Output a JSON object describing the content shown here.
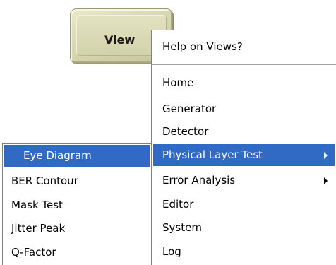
{
  "button": {
    "label": "View"
  },
  "menu": {
    "help": "Help on Views?",
    "items": [
      {
        "label": "Home",
        "has_submenu": false
      },
      {
        "label": "Generator",
        "has_submenu": false
      },
      {
        "label": "Detector",
        "has_submenu": false
      },
      {
        "label": "Physical Layer Test",
        "has_submenu": true,
        "selected": true
      },
      {
        "label": "Error Analysis",
        "has_submenu": true
      },
      {
        "label": "Editor",
        "has_submenu": false
      },
      {
        "label": "System",
        "has_submenu": false
      },
      {
        "label": "Log",
        "has_submenu": false
      }
    ]
  },
  "submenu": {
    "items": [
      {
        "label": "Eye Diagram",
        "selected": true
      },
      {
        "label": "BER Contour"
      },
      {
        "label": "Mask Test"
      },
      {
        "label": "Jitter Peak"
      },
      {
        "label": "Q-Factor"
      }
    ]
  },
  "colors": {
    "highlight": "#316ac5",
    "button_face": "#d7d7b1"
  },
  "icons": {
    "submenu_arrow": "triangle-right"
  }
}
